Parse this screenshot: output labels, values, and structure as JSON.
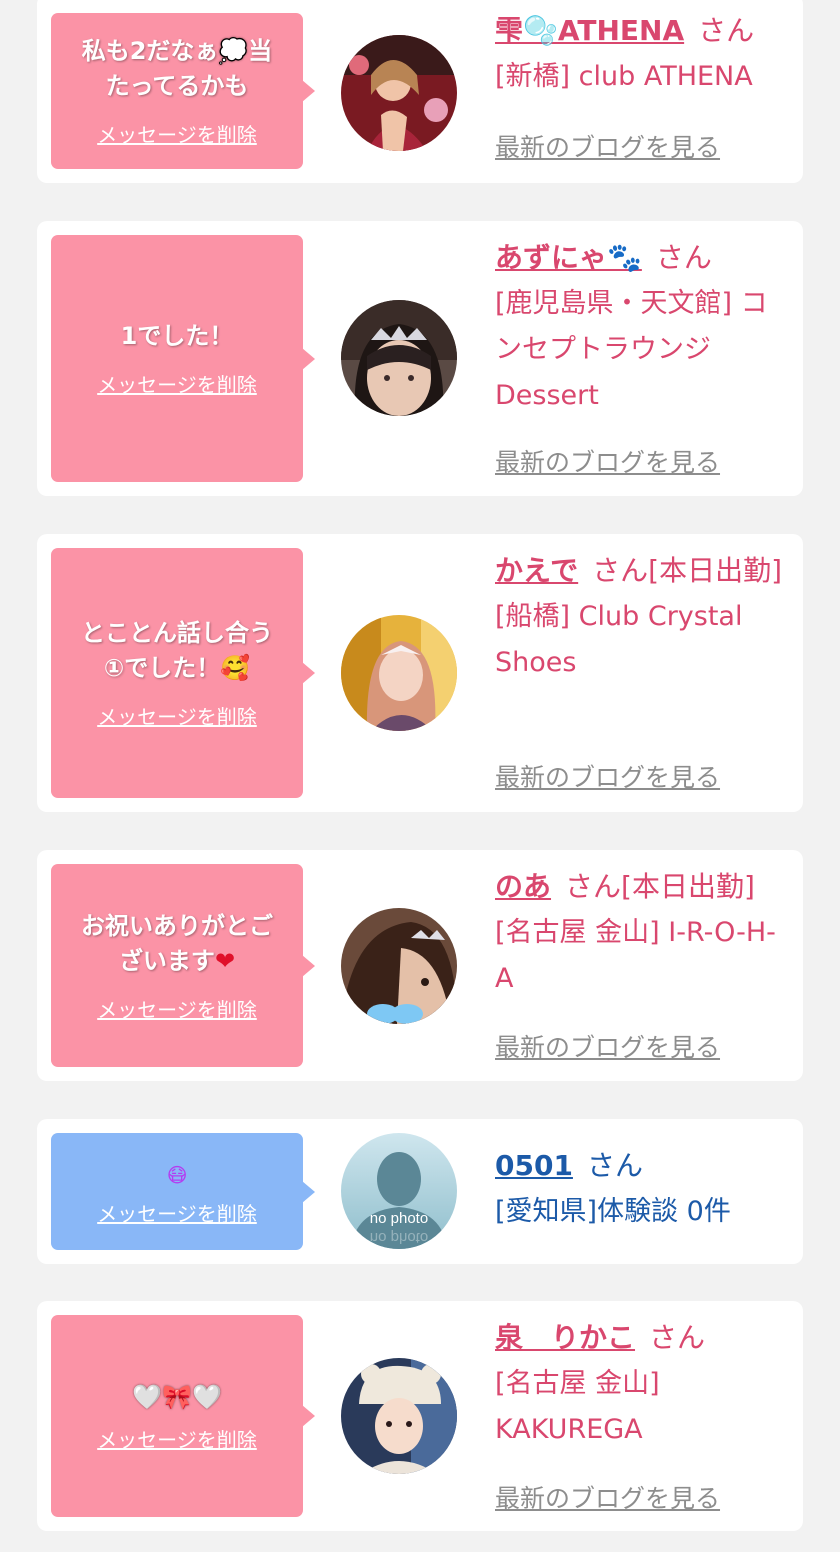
{
  "colors": {
    "page_bg": "#f2f2f2",
    "card_bg": "#ffffff",
    "bubble_pink": "#fb93a6",
    "bubble_blue": "#89b7f7",
    "text_pink": "#d9476e",
    "text_blue": "#1c5aa8",
    "link_gray": "#8d8d8d"
  },
  "common": {
    "delete_label": "メッセージを削除",
    "san_label": "さん",
    "blog_label": "最新のブログを見る"
  },
  "messages": [
    {
      "message": "私も2だなぁ💭当たってるかも",
      "name": "雫🫧ATHENA",
      "suffix": "さん",
      "shop": "[新橋] club ATHENA",
      "avatar": "cast-photo",
      "has_blog": true
    },
    {
      "message": "1でした！",
      "name": "あずにゃ🐾",
      "suffix": "さん",
      "shop": "[鹿児島県・天文館] コンセプトラウンジ Dessert",
      "avatar": "cast-photo",
      "has_blog": true
    },
    {
      "message": "とことん話し合う①でした！🥰",
      "name": "かえで",
      "suffix": "さん[本日出勤]",
      "shop": "[船橋] Club Crystal Shoes",
      "avatar": "cast-photo",
      "has_blog": true
    },
    {
      "message": "お祝いありがとございます❤️",
      "name": "のあ",
      "suffix": "さん[本日出勤]",
      "shop": "[名古屋 金山] I-R-O-H-A",
      "avatar": "cast-photo",
      "has_blog": true
    },
    {
      "message": "😷",
      "name": "0501",
      "suffix": "さん",
      "shop": "[愛知県]体験談 0件",
      "avatar": "no photo",
      "has_blog": false
    },
    {
      "message": "🤍🎀🤍",
      "name": "泉　りかこ",
      "suffix": "さん",
      "shop": "[名古屋 金山] KAKUREGA",
      "avatar": "cast-photo",
      "has_blog": true
    }
  ]
}
